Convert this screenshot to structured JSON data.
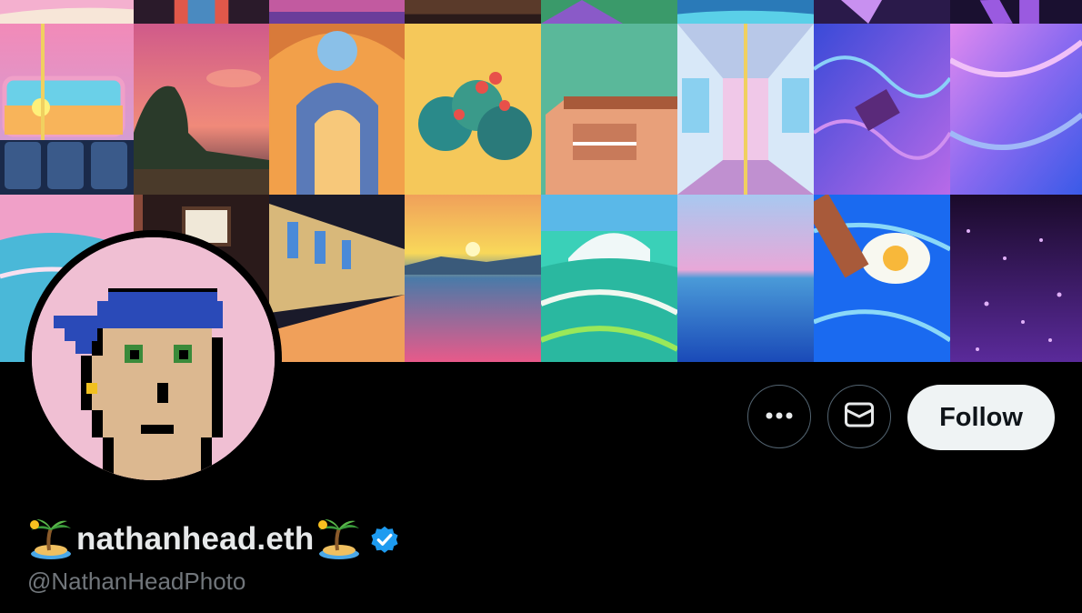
{
  "profile": {
    "display_name": "nathanhead.eth",
    "handle": "@NathanHeadPhoto",
    "verified": true,
    "name_emoji": "desert-island-emoji"
  },
  "actions": {
    "more_icon": "more-horizontal-icon",
    "message_icon": "mail-icon",
    "follow_label": "Follow"
  },
  "colors": {
    "background": "#000000",
    "follow_bg": "#eff3f4",
    "follow_text": "#0f1419",
    "name_text": "#e7e9ea",
    "handle_text": "#71767b",
    "verified_blue": "#1d9bf0",
    "avatar_bg": "#f0bfd3"
  },
  "banner": {
    "tiles": [
      {
        "c1": "#f4a2c8",
        "c2": "#f7e9d8"
      },
      {
        "c1": "#3a2a4a",
        "c2": "#e25b4a"
      },
      {
        "c1": "#d35a9c",
        "c2": "#6a3d9a"
      },
      {
        "c1": "#5a3a2a",
        "c2": "#f2a34a"
      },
      {
        "c1": "#3fa36a",
        "c2": "#8a5ac8"
      },
      {
        "c1": "#2a7ab8",
        "c2": "#5ad0e8"
      },
      {
        "c1": "#3a2a6a",
        "c2": "#c890f0"
      },
      {
        "c1": "#2a1a4a",
        "c2": "#9a5ae0"
      },
      {
        "c1": "#f28ab8",
        "c2": "#5ad0f0",
        "scene": "train-interior-pink"
      },
      {
        "c1": "#f07a9a",
        "c2": "#3a2a2a",
        "scene": "tree-sunset"
      },
      {
        "c1": "#f2a04a",
        "c2": "#3a6ab8",
        "scene": "cathedral"
      },
      {
        "c1": "#f7c85a",
        "c2": "#2a8a8a",
        "scene": "tree-yellow"
      },
      {
        "c1": "#5ab89a",
        "c2": "#e8a07a",
        "scene": "building"
      },
      {
        "c1": "#b8d8f0",
        "c2": "#f0c8e8",
        "scene": "train-interior-blue"
      },
      {
        "c1": "#3a4ad8",
        "c2": "#b86ae8",
        "scene": "water-blue"
      },
      {
        "c1": "#c86af0",
        "c2": "#3a5ae8",
        "scene": "water-violet"
      },
      {
        "c1": "#f0a0c8",
        "c2": "#3ab8d8",
        "scene": "sea-pink"
      },
      {
        "c1": "#2a1a1a",
        "c2": "#8a4a3a",
        "scene": "room-dark"
      },
      {
        "c1": "#1a1a2a",
        "c2": "#f0a05a",
        "scene": "train-station"
      },
      {
        "c1": "#f8d85a",
        "c2": "#e85a8a",
        "scene": "sunset-lake"
      },
      {
        "c1": "#3ad0b8",
        "c2": "#8ae85a",
        "scene": "wave-green"
      },
      {
        "c1": "#a8c8f0",
        "c2": "#2a6ad8",
        "scene": "sea-blue"
      },
      {
        "c1": "#1a6af0",
        "c2": "#5ad0f8",
        "scene": "pool-egg"
      },
      {
        "c1": "#1a0a2a",
        "c2": "#7a3ab8",
        "scene": "night-water"
      }
    ]
  }
}
